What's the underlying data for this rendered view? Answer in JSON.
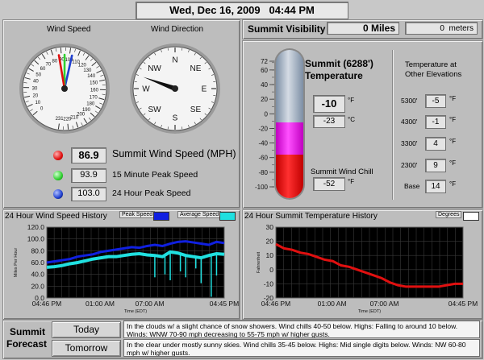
{
  "header": {
    "datetime": "Wed, Dec 16, 2009   04:44 PM"
  },
  "wind": {
    "speed_title": "Wind Speed",
    "direction_title": "Wind Direction",
    "speed_ticks": [
      "0",
      "10",
      "20",
      "30",
      "40",
      "50",
      "60",
      "70",
      "80",
      "90",
      "100",
      "110",
      "120",
      "130",
      "140",
      "150",
      "160",
      "170",
      "180",
      "190",
      "200",
      "210",
      "220",
      "231"
    ],
    "speed_needles": {
      "current": 86.9,
      "peak15": 93.9,
      "peak24": 103.0
    },
    "compass_labels": [
      "N",
      "NE",
      "E",
      "SE",
      "S",
      "SW",
      "W",
      "NW"
    ],
    "direction_deg": 290,
    "summit_value": "86.9",
    "summit_label": "Summit Wind Speed (MPH)",
    "peak15_value": "93.9",
    "peak15_label": "15 Minute Peak Speed",
    "peak24_value": "103.0",
    "peak24_label": "24 Hour Peak Speed",
    "colors": {
      "current": "#e01010",
      "peak15": "#30d030",
      "peak24": "#2040d0"
    }
  },
  "visibility": {
    "label": "Summit Visibility",
    "miles": "0 Miles",
    "meters_value": "0",
    "meters_unit": "meters"
  },
  "temperature": {
    "title": "Summit (6288') Temperature",
    "title_line1": "Summit (6288')",
    "title_line2": "Temperature",
    "scale_ticks": [
      "72",
      "60",
      "40",
      "20",
      "0",
      "-20",
      "-40",
      "-60",
      "-80",
      "-100"
    ],
    "value_f": "-10",
    "unit_f": "°F",
    "value_c": "-23",
    "unit_c": "°C",
    "windchill_label": "Summit Wind Chill",
    "windchill_value": "-52",
    "windchill_unit": "°F"
  },
  "elevations": {
    "title_line1": "Temperature at",
    "title_line2": "Other Elevations",
    "unit": "°F",
    "rows": [
      {
        "label": "5300'",
        "value": "-5"
      },
      {
        "label": "4300'",
        "value": "-1"
      },
      {
        "label": "3300'",
        "value": "4"
      },
      {
        "label": "2300'",
        "value": "9"
      },
      {
        "label": "Base",
        "value": "14"
      }
    ]
  },
  "wind_history": {
    "title": "24 Hour Wind Speed History",
    "legend": [
      {
        "label": "Peak Speed",
        "color": "#1020e0"
      },
      {
        "label": "Average Speed",
        "color": "#20e0e0"
      }
    ],
    "ylabel": "Miles Per Hour",
    "xlabel": "Time (EDT)",
    "yticks": [
      "120.0",
      "100.0",
      "80.0",
      "60.0",
      "40.0",
      "20.0",
      "0.0"
    ],
    "xticks": [
      "04:46 PM",
      "01:00 AM",
      "07:00 AM",
      "04:45 PM"
    ]
  },
  "temp_history": {
    "title": "24 Hour Summit Temperature History",
    "legend": [
      {
        "label": "Degrees",
        "color": "#e01010"
      }
    ],
    "ylabel": "Fahrenheit",
    "xlabel": "Time (EDT)",
    "yticks": [
      "30",
      "20",
      "10",
      "0",
      "-10",
      "-20"
    ],
    "xticks": [
      "04:46 PM",
      "01:00 AM",
      "07:00 AM",
      "04:45 PM"
    ]
  },
  "forecast": {
    "label_line1": "Summit",
    "label_line2": "Forecast",
    "today_label": "Today",
    "today_text": "In the clouds w/ a slight chance of snow showers. Wind chills 40-50 below.  Highs: Falling to around 10 below.  Winds: WNW 70-90 mph decreasing to 55-75 mph w/ higher gusts.",
    "tomorrow_label": "Tomorrow",
    "tomorrow_text": "In the clear under mostly sunny skies. Wind chills 35-45 below.  Highs: Mid single digits below.  Winds: NW 60-80 mph w/ higher gusts."
  },
  "chart_data": [
    {
      "type": "line",
      "title": "24 Hour Wind Speed History",
      "xlabel": "Time (EDT)",
      "ylabel": "Miles Per Hour",
      "ylim": [
        0,
        120
      ],
      "x": [
        "04:46 PM",
        "01:00 AM",
        "07:00 AM",
        "04:45 PM"
      ],
      "series": [
        {
          "name": "Peak Speed",
          "values": [
            60,
            62,
            64,
            66,
            70,
            72,
            74,
            78,
            80,
            82,
            84,
            86,
            85,
            88,
            90,
            88,
            92,
            95,
            96,
            94,
            92,
            90,
            95,
            93
          ]
        },
        {
          "name": "Average Speed",
          "values": [
            52,
            53,
            55,
            58,
            60,
            63,
            66,
            68,
            70,
            70,
            72,
            74,
            75,
            73,
            72,
            70,
            78,
            76,
            72,
            70,
            68,
            72,
            75,
            74
          ]
        }
      ],
      "grid": true
    },
    {
      "type": "line",
      "title": "24 Hour Summit Temperature History",
      "xlabel": "Time (EDT)",
      "ylabel": "Fahrenheit",
      "ylim": [
        -20,
        30
      ],
      "x": [
        "04:46 PM",
        "01:00 AM",
        "07:00 AM",
        "04:45 PM"
      ],
      "series": [
        {
          "name": "Degrees",
          "values": [
            18,
            15,
            14,
            12,
            11,
            9,
            7,
            6,
            3,
            2,
            0,
            -2,
            -4,
            -6,
            -9,
            -11,
            -12,
            -12,
            -12,
            -12,
            -12,
            -11,
            -10,
            -10
          ]
        }
      ],
      "grid": true
    }
  ]
}
